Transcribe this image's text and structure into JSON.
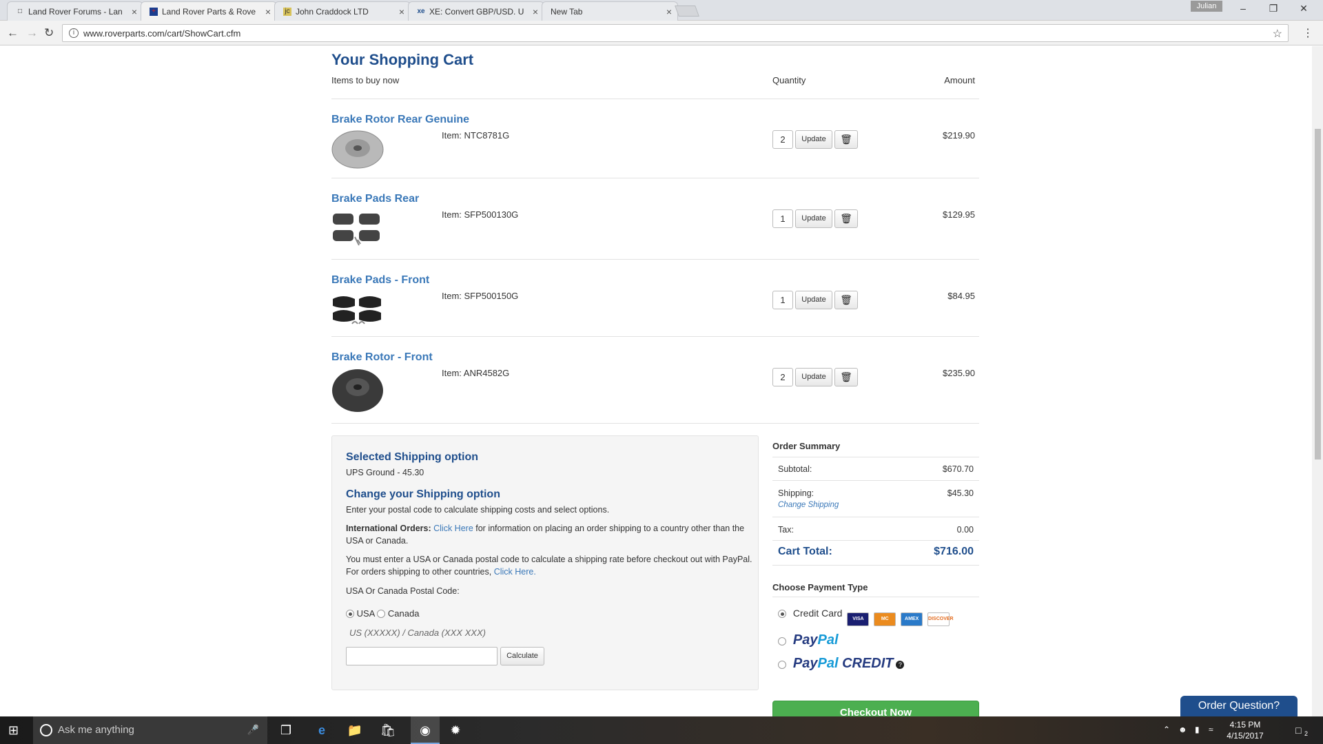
{
  "browser": {
    "tabs": [
      {
        "title": "Land Rover Forums - Lan",
        "favicon": "page-icon"
      },
      {
        "title": "Land Rover Parts & Rove",
        "favicon": "uk-flag-icon"
      },
      {
        "title": "John Craddock LTD",
        "favicon": "jc-icon"
      },
      {
        "title": "XE: Convert GBP/USD. U",
        "favicon": "xe-icon"
      },
      {
        "title": "New Tab",
        "favicon": ""
      }
    ],
    "profile": "Julian",
    "url": "www.roverparts.com/cart/ShowCart.cfm"
  },
  "cart": {
    "title": "Your Shopping Cart",
    "header_items": "Items to buy now",
    "header_qty": "Quantity",
    "header_amount": "Amount",
    "update_label": "Update",
    "items": [
      {
        "name": "Brake Rotor Rear Genuine",
        "code": "Item:  NTC8781G",
        "qty": "2",
        "amount": "$219.90"
      },
      {
        "name": "Brake Pads Rear",
        "code": "Item:  SFP500130G",
        "qty": "1",
        "amount": "$129.95"
      },
      {
        "name": "Brake Pads - Front",
        "code": "Item:  SFP500150G",
        "qty": "1",
        "amount": "$84.95"
      },
      {
        "name": "Brake Rotor - Front",
        "code": "Item:  ANR4582G",
        "qty": "2",
        "amount": "$235.90"
      }
    ]
  },
  "shipping": {
    "selected_title": "Selected Shipping option",
    "selected_value": "UPS Ground - 45.30",
    "change_title": "Change your Shipping option",
    "instructions": "Enter your postal code to calculate shipping costs and select options.",
    "intl_label": "International Orders:",
    "intl_link": "Click Here",
    "intl_text": " for information on placing an order shipping to a country other than the USA or Canada.",
    "paypal_text": "You must enter a USA or Canada postal code to calculate a shipping rate before checkout out with PayPal. For orders shipping to other countries, ",
    "paypal_link": "Click Here.",
    "postal_label": "USA Or Canada Postal Code:",
    "country_usa": "USA",
    "country_canada": "Canada",
    "format_hint": "US (XXXXX) / Canada (XXX XXX)",
    "calculate_label": "Calculate"
  },
  "summary": {
    "title": "Order Summary",
    "subtotal_label": "Subtotal:",
    "subtotal_value": "$670.70",
    "shipping_label": "Shipping:",
    "shipping_value": "$45.30",
    "change_shipping": "Change Shipping",
    "tax_label": "Tax:",
    "tax_value": "0.00",
    "total_label": "Cart Total:",
    "total_value": "$716.00",
    "payment_title": "Choose Payment Type",
    "credit_card": "Credit Card",
    "cards": [
      "VISA",
      "MC",
      "AMEX",
      "DISCOVER"
    ],
    "paypal_a": "Pay",
    "paypal_b": "Pal",
    "paypal_credit": "CREDIT",
    "checkout": "Checkout Now"
  },
  "order_question": "Order Question?",
  "taskbar": {
    "search_placeholder": "Ask me anything",
    "time": "4:15 PM",
    "date": "4/15/2017",
    "notifications": "2"
  },
  "colors": {
    "brand_blue": "#1f4e8c",
    "link_blue": "#3a78b8",
    "checkout_green": "#4caf50"
  }
}
